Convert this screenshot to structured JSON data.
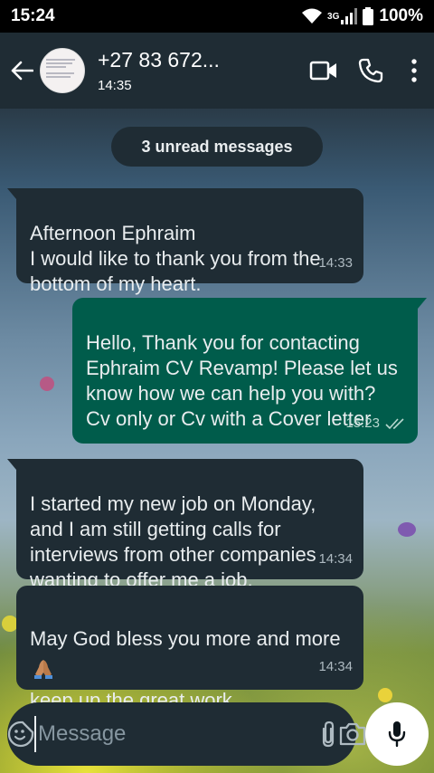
{
  "status_bar": {
    "time": "15:24",
    "network": "3G",
    "battery": "100%"
  },
  "header": {
    "contact_name": "+27 83 672...",
    "subtitle": "14:35"
  },
  "chat": {
    "unread_label": "3 unread messages",
    "messages": [
      {
        "direction": "incoming",
        "text": "Afternoon Ephraim\nI would like to thank you from the bottom of my heart.",
        "time": "14:33"
      },
      {
        "direction": "outgoing",
        "text": "Hello, Thank you for contacting Ephraim CV Revamp! Please let us know how we can help you with? Cv only or Cv with a Cover letter",
        "time": "15:23",
        "read": true
      },
      {
        "direction": "incoming",
        "text": "I started my new job on Monday, and I am still getting calls for interviews from other companies wanting to offer me a job.",
        "time": "14:34"
      },
      {
        "direction": "incoming",
        "text_before": "May God bless you more and more",
        "emoji": "folded-hands",
        "text_after": "keep up the great work.",
        "time": "14:34"
      }
    ]
  },
  "composer": {
    "placeholder": "Message"
  },
  "colors": {
    "header_bg": "#1f2c34",
    "incoming_bubble": "#1f2c34",
    "outgoing_bubble": "#005c4b"
  }
}
